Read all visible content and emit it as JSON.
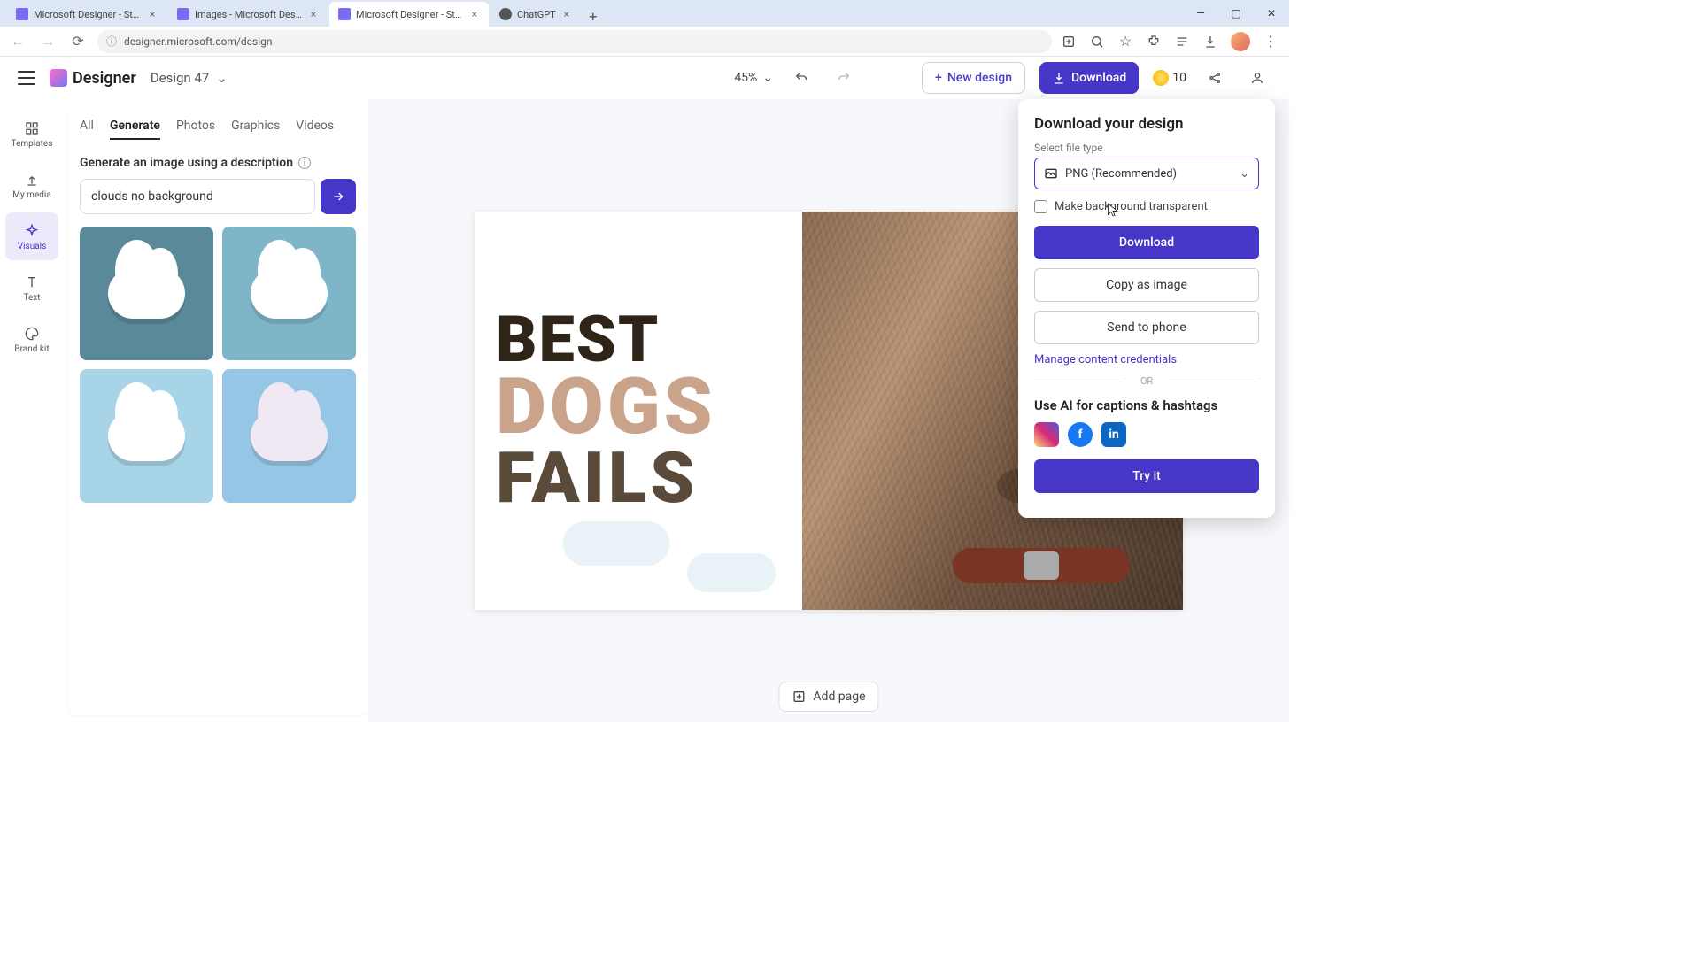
{
  "browser": {
    "tabs": [
      {
        "title": "Microsoft Designer - Stunning",
        "active": false,
        "kind": "designer"
      },
      {
        "title": "Images - Microsoft Designer",
        "active": false,
        "kind": "designer"
      },
      {
        "title": "Microsoft Designer - Stunning",
        "active": true,
        "kind": "designer"
      },
      {
        "title": "ChatGPT",
        "active": false,
        "kind": "chatgpt"
      }
    ],
    "url": "designer.microsoft.com/design"
  },
  "app": {
    "brand": "Designer",
    "document_title": "Design 47",
    "zoom": "45%",
    "new_design_label": "New design",
    "download_label": "Download",
    "credits": "10"
  },
  "rail": {
    "items": [
      {
        "key": "templates",
        "label": "Templates"
      },
      {
        "key": "mymedia",
        "label": "My media"
      },
      {
        "key": "visuals",
        "label": "Visuals",
        "active": true
      },
      {
        "key": "text",
        "label": "Text"
      },
      {
        "key": "brandkit",
        "label": "Brand kit"
      }
    ]
  },
  "panel": {
    "tabs": [
      "All",
      "Generate",
      "Photos",
      "Graphics",
      "Videos"
    ],
    "active_tab": "Generate",
    "heading": "Generate an image using a description",
    "prompt_value": "clouds no background"
  },
  "canvas": {
    "text_lines": {
      "line1": "BEST",
      "line2": "DOGS",
      "line3": "FAILS"
    },
    "add_page_label": "Add page"
  },
  "popover": {
    "title": "Download your design",
    "select_label": "Select file type",
    "file_type": "PNG (Recommended)",
    "transparent_label": "Make background transparent",
    "download_btn": "Download",
    "copy_btn": "Copy as image",
    "send_btn": "Send to phone",
    "manage_link": "Manage content credentials",
    "or": "OR",
    "ai_title": "Use AI for captions & hashtags",
    "try_btn": "Try it"
  }
}
